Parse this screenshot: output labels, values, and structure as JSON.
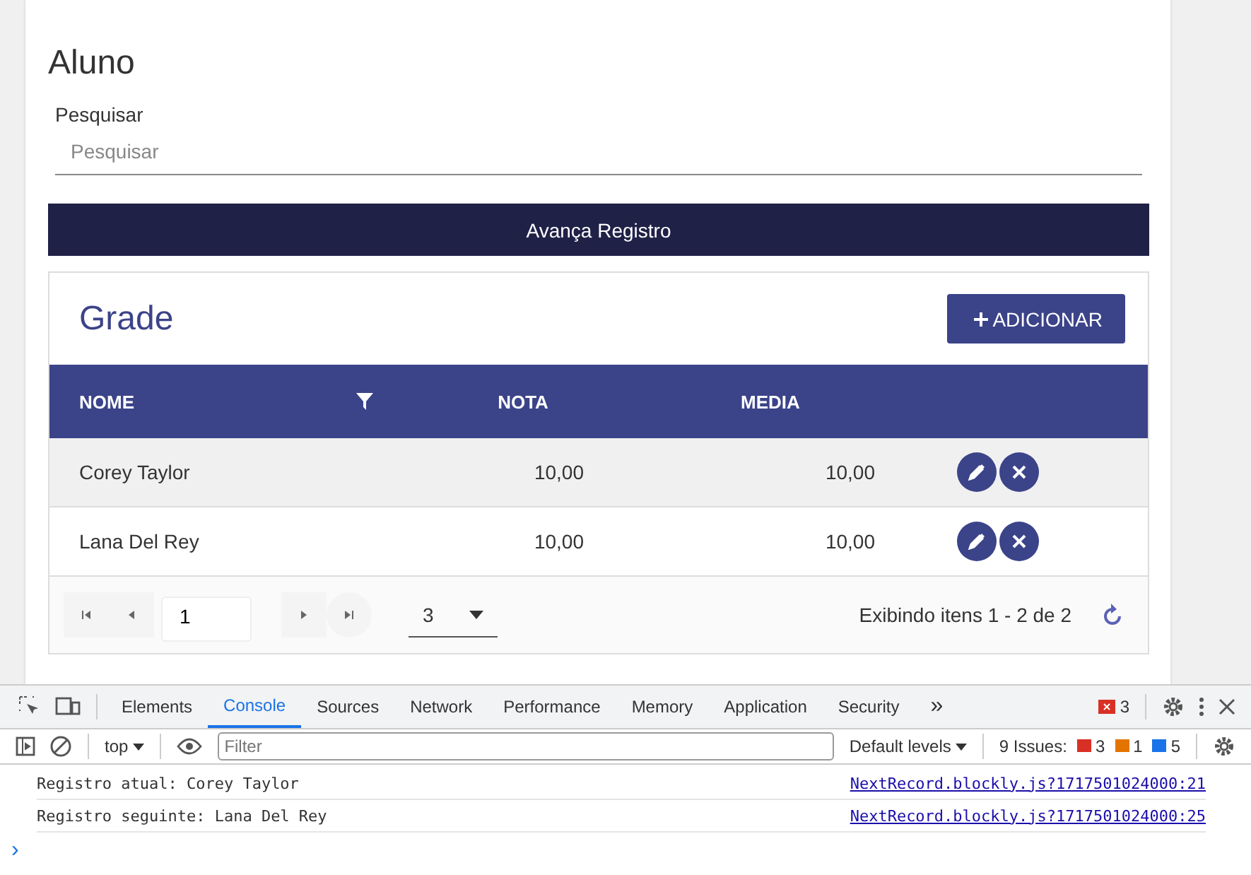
{
  "form": {
    "title": "Aluno",
    "search_label": "Pesquisar",
    "search_placeholder": "Pesquisar",
    "advance_button": "Avança Registro"
  },
  "grid": {
    "title": "Grade",
    "add_button": "ADICIONAR",
    "columns": [
      {
        "label": "NOME",
        "filter": true
      },
      {
        "label": "NOTA",
        "filter": false
      },
      {
        "label": "MEDIA",
        "filter": false
      }
    ],
    "rows": [
      {
        "nome": "Corey Taylor",
        "nota": "10,00",
        "media": "10,00",
        "selected": true
      },
      {
        "nome": "Lana Del Rey",
        "nota": "10,00",
        "media": "10,00",
        "selected": false
      }
    ],
    "pager": {
      "page": "1",
      "page_size": "3",
      "info": "Exibindo itens 1 - 2 de 2"
    }
  },
  "devtools": {
    "tabs": [
      {
        "label": "Elements",
        "selected": false
      },
      {
        "label": "Console",
        "selected": true
      },
      {
        "label": "Sources",
        "selected": false
      },
      {
        "label": "Network",
        "selected": false
      },
      {
        "label": "Performance",
        "selected": false
      },
      {
        "label": "Memory",
        "selected": false
      },
      {
        "label": "Application",
        "selected": false
      },
      {
        "label": "Security",
        "selected": false
      }
    ],
    "more": "»",
    "error_count": "3",
    "context": "top",
    "filter_placeholder": "Filter",
    "levels": "Default levels",
    "issues_label": "9 Issues:",
    "issues": [
      {
        "count": "3",
        "color": "#d93025"
      },
      {
        "count": "1",
        "color": "#e37400"
      },
      {
        "count": "5",
        "color": "#1a73e8"
      }
    ],
    "messages": [
      {
        "text": "Registro atual: Corey Taylor",
        "source": "NextRecord.blockly.js?1717501024000:21"
      },
      {
        "text": "Registro seguinte: Lana Del Rey",
        "source": "NextRecord.blockly.js?1717501024000:25"
      }
    ],
    "prompt": "›"
  }
}
